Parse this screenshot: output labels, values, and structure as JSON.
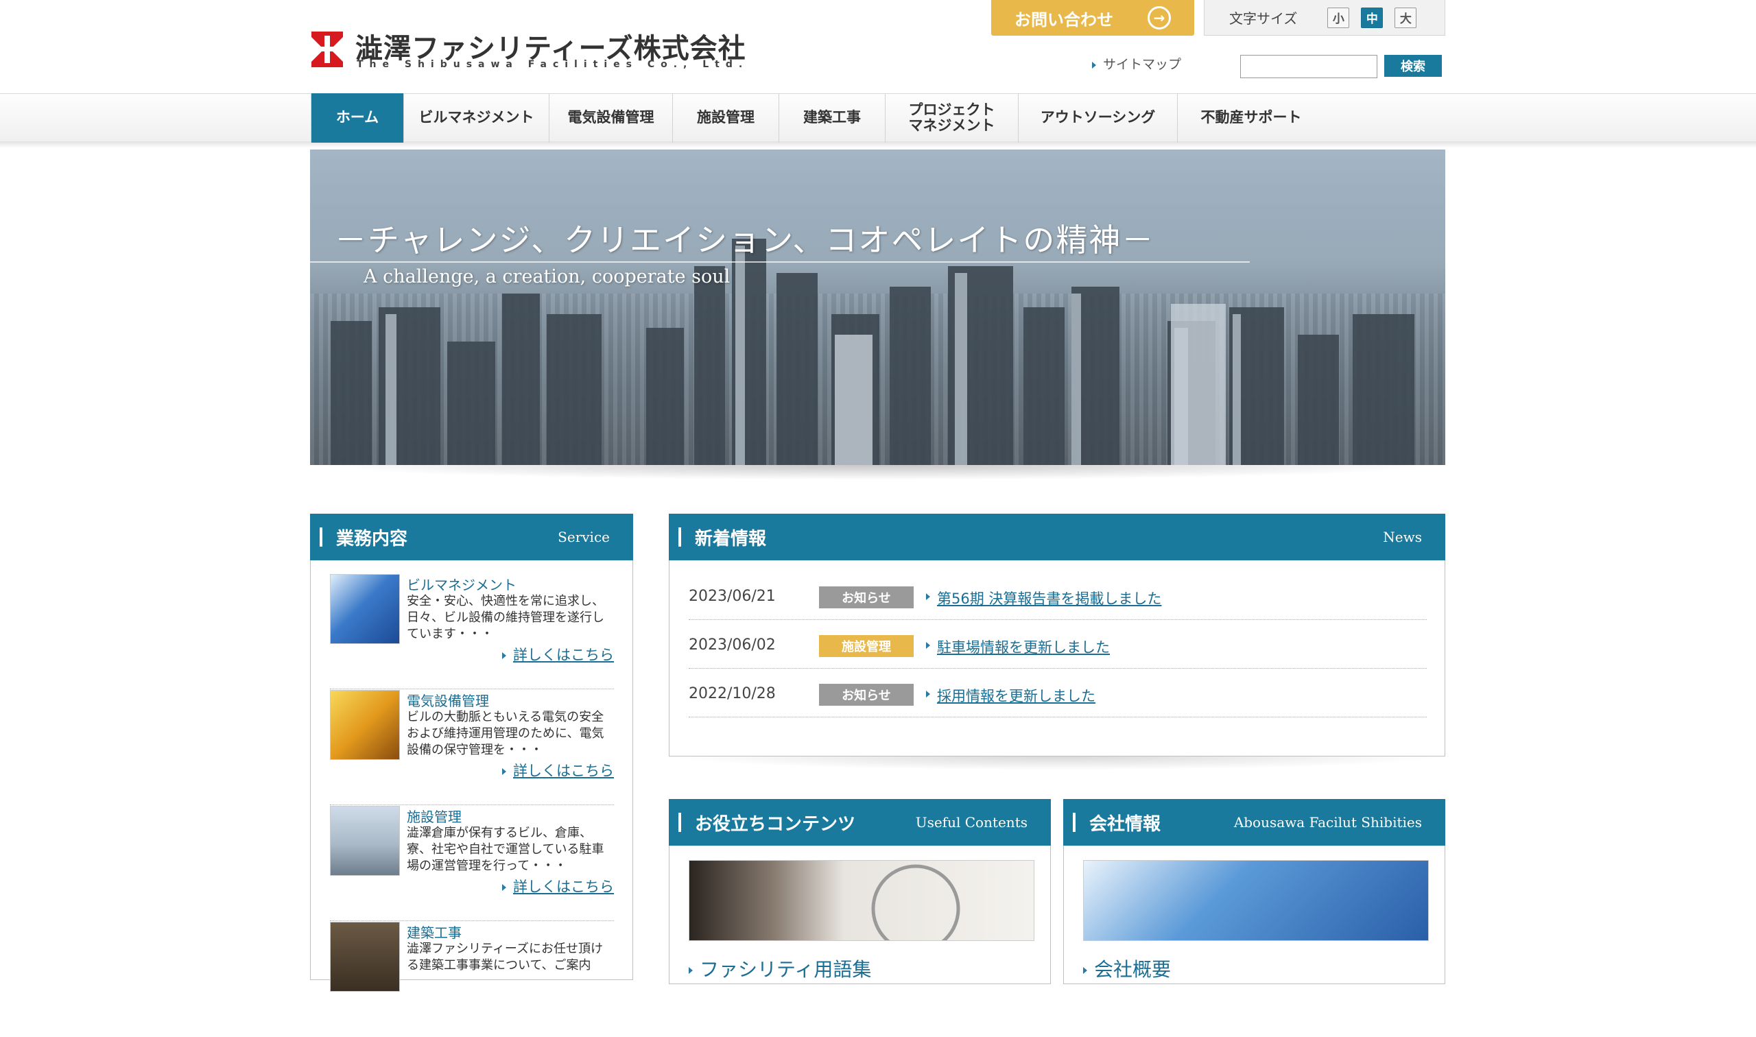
{
  "header": {
    "logo_name": "澁澤ファシリティーズ株式会社",
    "logo_sub": "The Shibusawa Facilities Co., Ltd.",
    "contact_label": "お問い合わせ",
    "font_size_label": "文字サイズ",
    "font_sizes": [
      "小",
      "中",
      "大"
    ],
    "font_size_selected": "中",
    "sitemap_label": "サイトマップ",
    "search_value": "",
    "search_button": "検索"
  },
  "nav": {
    "items": [
      {
        "label": "ホーム",
        "active": true
      },
      {
        "label": "ビルマネジメント",
        "active": false
      },
      {
        "label": "電気設備管理",
        "active": false
      },
      {
        "label": "施設管理",
        "active": false
      },
      {
        "label": "建築工事",
        "active": false
      },
      {
        "label": "プロジェクト\nマネジメント",
        "active": false
      },
      {
        "label": "アウトソーシング",
        "active": false
      },
      {
        "label": "不動産サポート",
        "active": false
      }
    ]
  },
  "hero": {
    "title": "－チャレンジ、クリエイション、コオペレイトの精神－",
    "subtitle": "A challenge, a creation, cooperate soul"
  },
  "service": {
    "title": "業務内容",
    "title_en": "Service",
    "more_label": "詳しくはこちら",
    "items": [
      {
        "name": "ビルマネジメント",
        "desc": "安全・安心、快適性を常に追求し、日々、ビル設備の維持管理を遂行しています・・・"
      },
      {
        "name": "電気設備管理",
        "desc": "ビルの大動脈ともいえる電気の安全および維持運用管理のために、電気設備の保守管理を・・・"
      },
      {
        "name": "施設管理",
        "desc": "澁澤倉庫が保有するビル、倉庫、寮、社宅や自社で運営している駐車場の運営管理を行って・・・"
      },
      {
        "name": "建築工事",
        "desc": "澁澤ファシリティーズにお任せ頂ける建築工事事業について、ご案内"
      }
    ]
  },
  "news": {
    "title": "新着情報",
    "title_en": "News",
    "items": [
      {
        "date": "2023/06/21",
        "tag": "お知らせ",
        "tag_color": "#9a9a9a",
        "title": "第56期 決算報告書を掲載しました"
      },
      {
        "date": "2023/06/02",
        "tag": "施設管理",
        "tag_color": "#e8b84a",
        "title": "駐車場情報を更新しました"
      },
      {
        "date": "2022/10/28",
        "tag": "お知らせ",
        "tag_color": "#9a9a9a",
        "title": "採用情報を更新しました"
      }
    ]
  },
  "useful": {
    "title": "お役立ちコンテンツ",
    "title_en": "Useful Contents",
    "link": "ファシリティ用語集"
  },
  "company": {
    "title": "会社情報",
    "title_en": "Abousawa Facilut Shibities",
    "link": "会社概要"
  },
  "colors": {
    "accent": "#1a7a9e",
    "contact": "#e8b84a",
    "link": "#1a6d93"
  }
}
